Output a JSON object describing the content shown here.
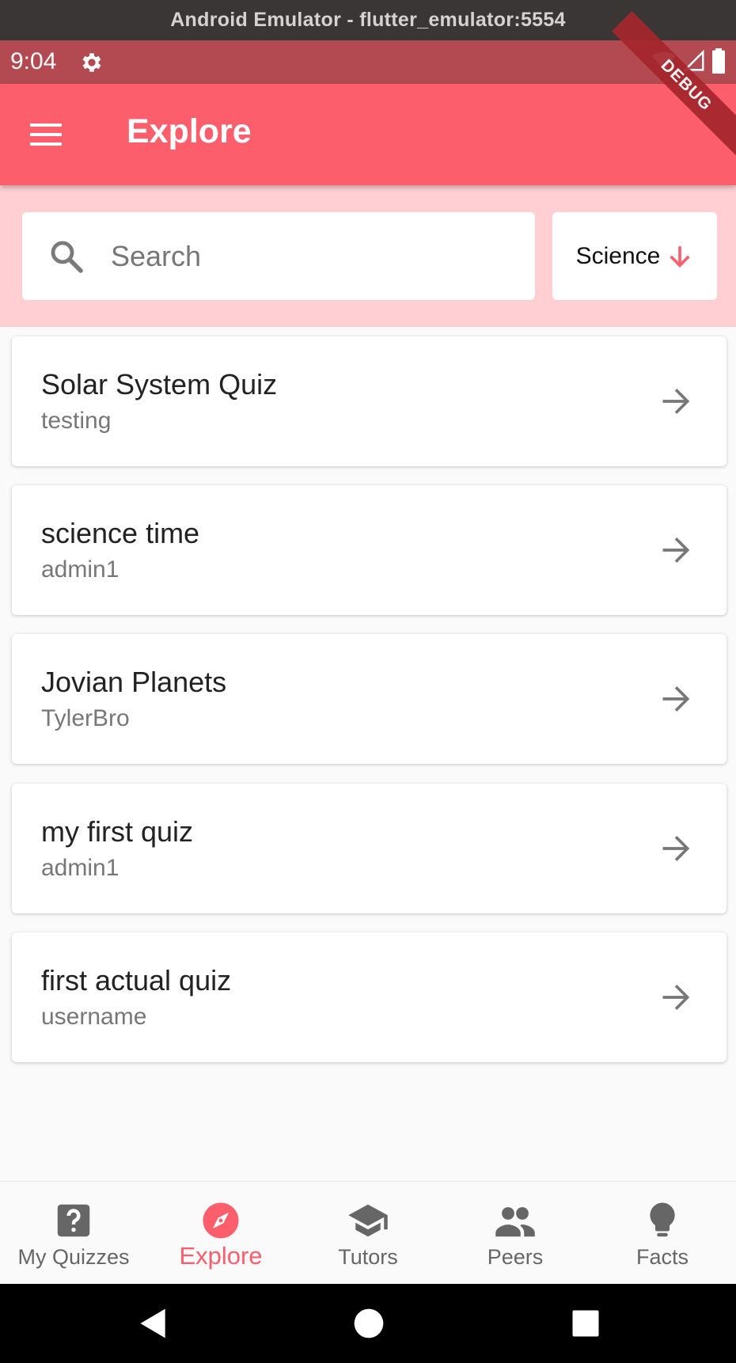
{
  "window": {
    "title": "Android Emulator - flutter_emulator:5554"
  },
  "status_bar": {
    "time": "9:04",
    "icons": [
      "settings-icon",
      "wifi-icon",
      "signal-icon",
      "battery-icon"
    ]
  },
  "app_bar": {
    "title": "Explore",
    "debug_banner": "DEBUG",
    "menu_icon": "menu-icon"
  },
  "search": {
    "placeholder": "Search",
    "value": ""
  },
  "category_filter": {
    "label": "Science",
    "icon": "arrow-down-icon"
  },
  "quizzes": [
    {
      "title": "Solar System Quiz",
      "author": "testing"
    },
    {
      "title": "science time",
      "author": "admin1"
    },
    {
      "title": "Jovian Planets",
      "author": "TylerBro"
    },
    {
      "title": "my first quiz",
      "author": "admin1"
    },
    {
      "title": "first actual quiz",
      "author": "username"
    }
  ],
  "bottom_nav": {
    "items": [
      {
        "label": "My Quizzes",
        "icon": "help-box-icon",
        "active": false
      },
      {
        "label": "Explore",
        "icon": "compass-icon",
        "active": true
      },
      {
        "label": "Tutors",
        "icon": "graduation-cap-icon",
        "active": false
      },
      {
        "label": "Peers",
        "icon": "people-icon",
        "active": false
      },
      {
        "label": "Facts",
        "icon": "lightbulb-icon",
        "active": false
      }
    ]
  },
  "system_nav": {
    "icons": [
      "back-icon",
      "home-icon",
      "recents-icon"
    ]
  },
  "colors": {
    "app_bar": "#fc5e6b",
    "status_bar": "#b44a51",
    "search_area": "#ffcfd3",
    "accent": "#fc5e6b",
    "window_title_bar": "#3b3636"
  }
}
